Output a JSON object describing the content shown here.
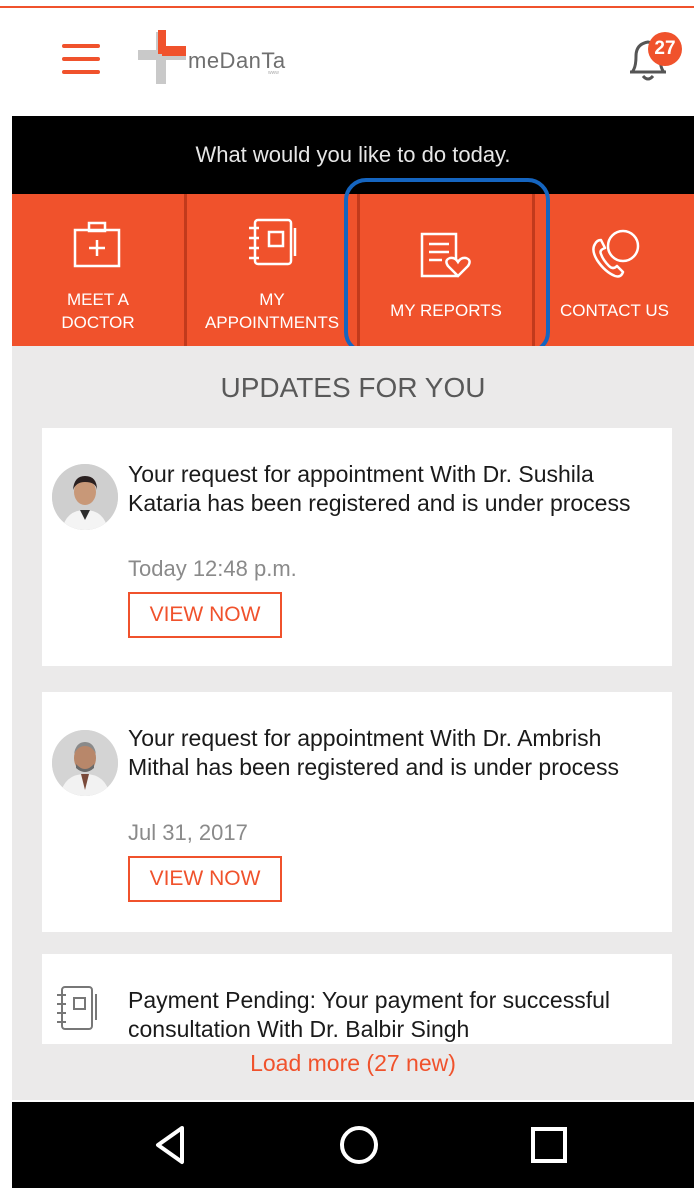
{
  "app": {
    "logo_text": "meDanTa",
    "logo_sub": "www"
  },
  "header": {
    "notification_count": "27"
  },
  "prompt": "What would you like to do today.",
  "actions": [
    {
      "line1": "MEET A",
      "line2": "DOCTOR",
      "icon": "medical-kit-icon"
    },
    {
      "line1": "MY",
      "line2": "APPOINTMENTS",
      "icon": "planner-icon"
    },
    {
      "line1": "MY REPORTS",
      "icon": "report-heart-icon"
    },
    {
      "line1": "CONTACT US",
      "icon": "phone-chat-icon"
    }
  ],
  "updates": {
    "title": "UPDATES FOR YOU",
    "items": [
      {
        "message": "Your request for appointment  With Dr. Sushila Kataria has been registered and is under process",
        "time": "Today 12:48 p.m.",
        "button": "VIEW NOW"
      },
      {
        "message": "Your request for appointment  With Dr. Ambrish Mithal has been registered and is under process",
        "time": "Jul 31, 2017",
        "button": "VIEW NOW"
      },
      {
        "message": "Payment Pending: Your payment for successful consultation  With Dr. Balbir Singh"
      }
    ]
  },
  "load_more": "Load more (27 new)",
  "colors": {
    "accent": "#f0522c",
    "highlight": "#1565c0",
    "bar": "#000000",
    "background": "#ebeaea"
  }
}
